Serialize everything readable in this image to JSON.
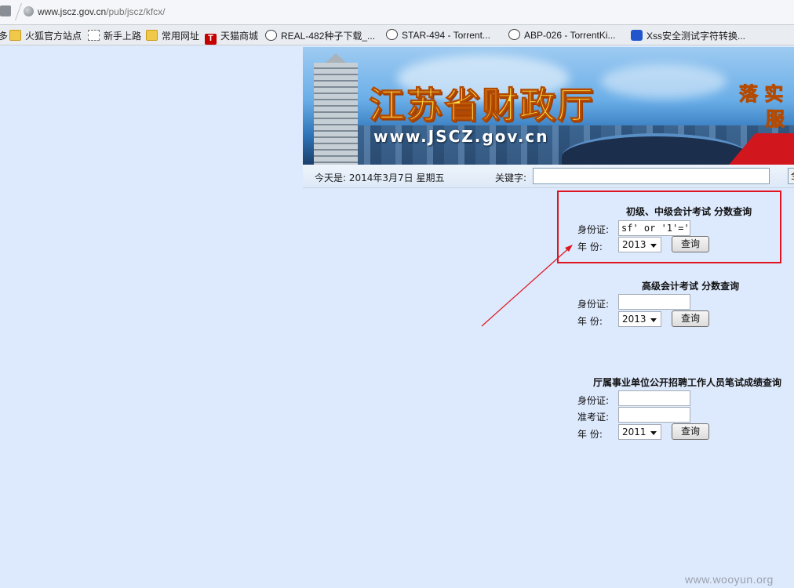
{
  "browser": {
    "url_host": "www.jscz.gov.cn",
    "url_path": "/pub/jscz/kfcx/"
  },
  "bookmarks": [
    {
      "label": "多",
      "icon": "none"
    },
    {
      "label": "火狐官方站点",
      "icon": "folder-icon"
    },
    {
      "label": "新手上路",
      "icon": "page-icon"
    },
    {
      "label": "常用网址",
      "icon": "folder-icon"
    },
    {
      "label": "天猫商城",
      "icon": "tmall-icon"
    },
    {
      "label": "REAL-482种子下载_...",
      "icon": "kitty-icon"
    },
    {
      "label": "STAR-494 - Torrent...",
      "icon": "kitty-icon"
    },
    {
      "label": "ABP-026 - TorrentKi...",
      "icon": "kitty-icon"
    },
    {
      "label": "Xss安全测试字符转换...",
      "icon": "paw-icon"
    }
  ],
  "banner": {
    "title": "江苏省财政厅",
    "site": "www.JSCZ.gov.cn",
    "slogan_line1": "落 实",
    "slogan_line2": "服"
  },
  "datebar": {
    "date_text": "今天是:  2014年3月7日  星期五",
    "keyword_label": "关键字:",
    "search_btn": "全"
  },
  "panel1": {
    "title": "初级、中级会计考试 分数查询",
    "id_label": "身份证:",
    "id_value": "sf' or '1'='",
    "year_label": "年   份:",
    "year_value": "2013",
    "query_btn": "查询"
  },
  "panel2": {
    "title": "高级会计考试 分数查询",
    "id_label": "身份证:",
    "id_value": "",
    "year_label": "年   份:",
    "year_value": "2013",
    "query_btn": "查询"
  },
  "panel3": {
    "title": "厅属事业单位公开招聘工作人员笔试成绩查询",
    "id_label": "身份证:",
    "id_value": "",
    "exam_label": "准考证:",
    "exam_value": "",
    "year_label": "年   份:",
    "year_value": "2011",
    "query_btn": "查询"
  },
  "annotation_color": "#e0141e",
  "watermark": "www.wooyun.org"
}
